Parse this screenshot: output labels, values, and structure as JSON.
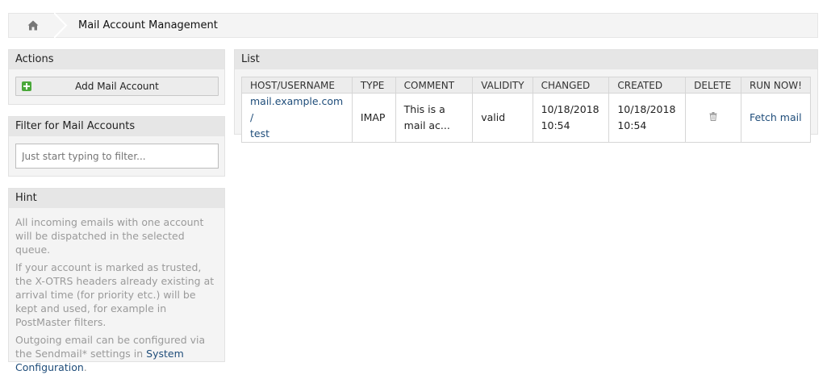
{
  "breadcrumb": {
    "home_icon": "home-icon",
    "title": "Mail Account Management"
  },
  "actions": {
    "header": "Actions",
    "add_button": "Add Mail Account",
    "add_icon": "plus-icon",
    "accent": "#4aa83a"
  },
  "filter": {
    "header": "Filter for Mail Accounts",
    "placeholder": "Just start typing to filter..."
  },
  "hint": {
    "header": "Hint",
    "p1": "All incoming emails with one account will be dispatched in the selected queue.",
    "p2": "If your account is marked as trusted, the X-OTRS headers already existing at arrival time (for priority etc.) will be kept and used, for example in PostMaster filters.",
    "p3_before": "Outgoing email can be configured via the Sendmail* settings in ",
    "p3_link": "System Configuration",
    "p3_after": "."
  },
  "list": {
    "header": "List",
    "columns": [
      "HOST/USERNAME",
      "TYPE",
      "COMMENT",
      "VALIDITY",
      "CHANGED",
      "CREATED",
      "DELETE",
      "RUN NOW!"
    ],
    "rows": [
      {
        "host_line1": "mail.example.com /",
        "host_line2": "test",
        "type": "IMAP",
        "comment_line1": "This is a",
        "comment_line2": "mail ac...",
        "validity": "valid",
        "changed_line1": "10/18/2018",
        "changed_line2": "10:54",
        "created_line1": "10/18/2018",
        "created_line2": "10:54",
        "delete_icon": "trash-icon",
        "run_now": "Fetch mail"
      }
    ]
  },
  "colors": {
    "link": "#1f4d7a",
    "panel": "#f4f4f4",
    "header": "#e6e6e6",
    "hint_text": "#9a9a9a"
  }
}
